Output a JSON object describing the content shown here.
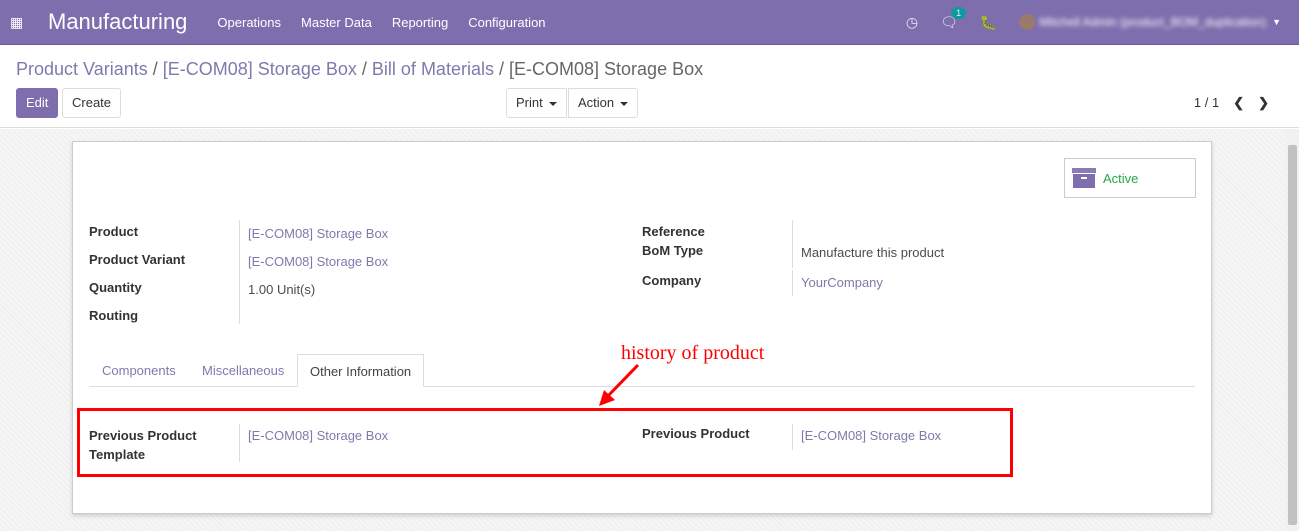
{
  "nav": {
    "app_title": "Manufacturing",
    "menu": [
      "Operations",
      "Master Data",
      "Reporting",
      "Configuration"
    ],
    "chat_badge": "1",
    "user_name": "Mitchell Admin (product_BOM_duplication)"
  },
  "breadcrumb": {
    "items": [
      "Product Variants",
      "[E-COM08] Storage Box",
      "Bill of Materials"
    ],
    "current": "[E-COM08] Storage Box"
  },
  "toolbar": {
    "edit": "Edit",
    "create": "Create",
    "print": "Print",
    "action": "Action",
    "pager": "1 / 1"
  },
  "sheet": {
    "active_label": "Active",
    "left_fields": [
      {
        "label": "Product",
        "value": "[E-COM08] Storage Box"
      },
      {
        "label": "Product Variant",
        "value": "[E-COM08] Storage Box"
      },
      {
        "label": "Quantity",
        "value": "1.00",
        "unit": "Unit(s)"
      },
      {
        "label": "Routing",
        "value": ""
      }
    ],
    "right_fields": [
      {
        "label": "Reference",
        "value": ""
      },
      {
        "label": "BoM Type",
        "value": "Manufacture this product"
      },
      {
        "label": "Company",
        "value": "YourCompany"
      }
    ],
    "tabs": [
      "Components",
      "Miscellaneous",
      "Other Information"
    ],
    "other_info": {
      "prev_template_label": "Previous Product Template",
      "prev_template_value": "[E-COM08] Storage Box",
      "prev_product_label": "Previous Product",
      "prev_product_value": "[E-COM08] Storage Box"
    }
  },
  "annotation": "history of product"
}
